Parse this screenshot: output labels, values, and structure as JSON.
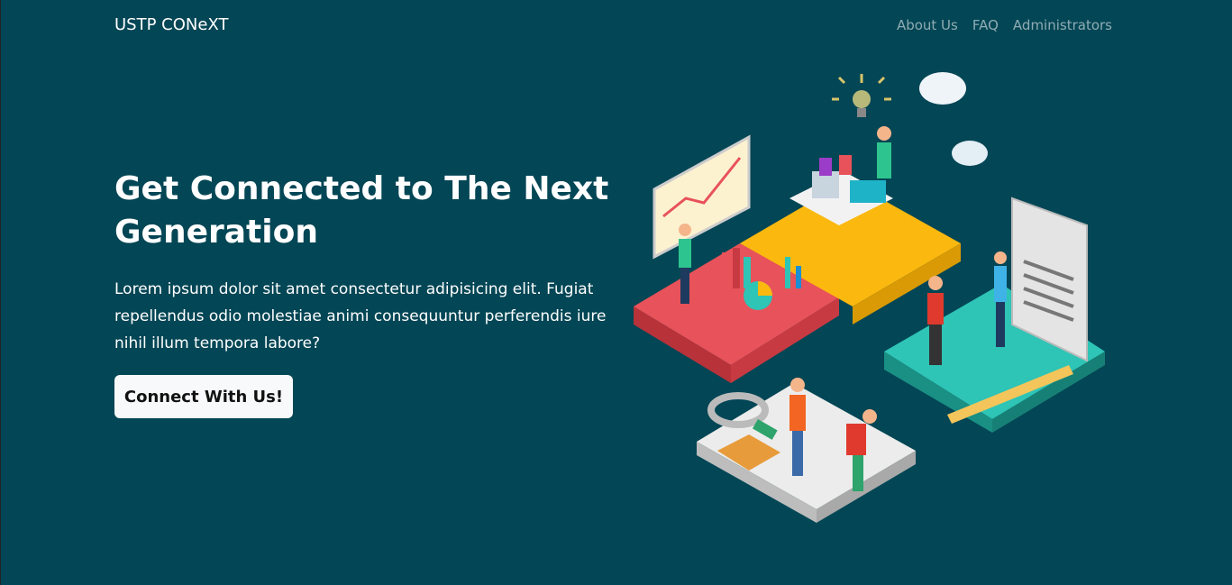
{
  "navbar": {
    "brand": "USTP CONeXT",
    "links": [
      {
        "label": "About Us"
      },
      {
        "label": "FAQ"
      },
      {
        "label": "Administrators"
      }
    ]
  },
  "hero": {
    "title": "Get Connected to The Next Generation",
    "text": "Lorem ipsum dolor sit amet consectetur adipisicing elit. Fugiat repellendus odio molestiae animi consequuntur perferendis iure nihil illum tempora labore?",
    "cta_label": "Connect With Us!"
  },
  "colors": {
    "background": "#034655",
    "puzzle_red": "#e8525a",
    "puzzle_yellow": "#fbb80f",
    "puzzle_teal": "#2ec4b6",
    "puzzle_gray": "#ececec"
  }
}
